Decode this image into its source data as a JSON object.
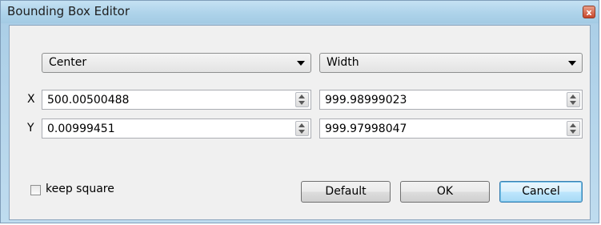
{
  "window": {
    "title": "Bounding Box Editor",
    "close_symbol": "x"
  },
  "mode_selectors": {
    "position_mode": "Center",
    "size_mode": "Width"
  },
  "rows": [
    {
      "axis": "X",
      "position": "500.00500488",
      "size": "999.98999023"
    },
    {
      "axis": "Y",
      "position": "0.00999451",
      "size": "999.97998047"
    }
  ],
  "keep_square": {
    "label": "keep square",
    "checked": false
  },
  "buttons": {
    "default": "Default",
    "ok": "OK",
    "cancel": "Cancel"
  },
  "colors": {
    "titlebar": "#aed3ea",
    "dialog_bg": "#f0f0f0",
    "focus_border": "#3c7fb1"
  }
}
